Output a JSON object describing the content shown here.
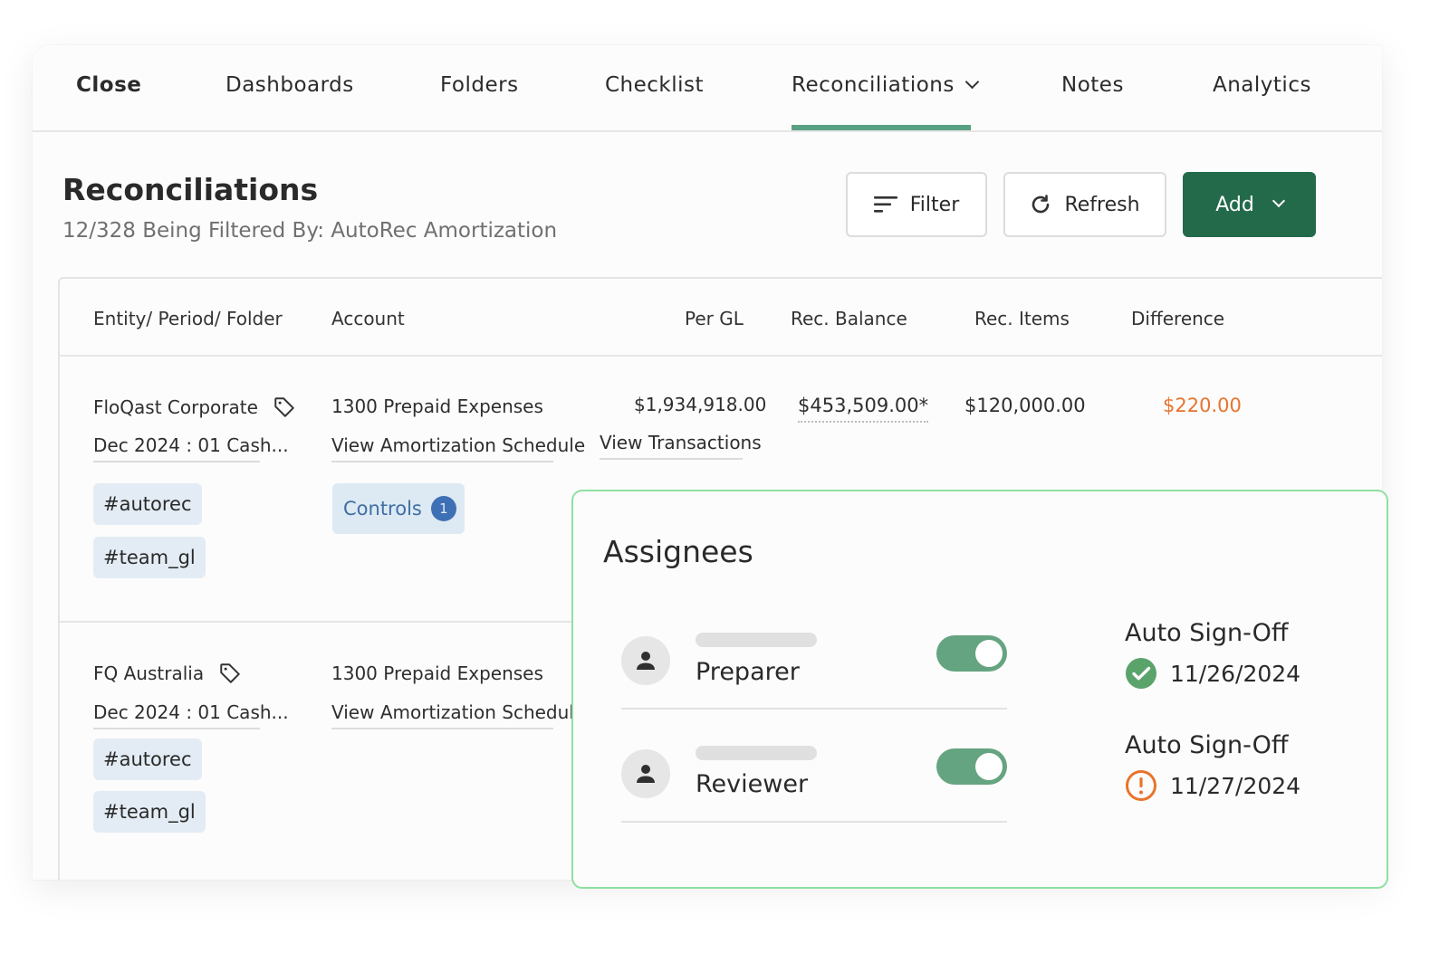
{
  "nav": {
    "items": [
      {
        "label": "Close"
      },
      {
        "label": "Dashboards"
      },
      {
        "label": "Folders"
      },
      {
        "label": "Checklist"
      },
      {
        "label": "Reconciliations"
      },
      {
        "label": "Notes"
      },
      {
        "label": "Analytics"
      }
    ],
    "active": "Reconciliations"
  },
  "page": {
    "title": "Reconciliations",
    "subtitle": "12/328 Being Filtered By: AutoRec Amortization"
  },
  "toolbar": {
    "filter_label": "Filter",
    "refresh_label": "Refresh",
    "add_label": "Add"
  },
  "table": {
    "columns": [
      "Entity/ Period/ Folder",
      "Account",
      "Per GL",
      "Rec. Balance",
      "Rec. Items",
      "Difference"
    ],
    "rows": [
      {
        "entity": "FloQast Corporate",
        "period": "Dec 2024 : 01 Cash...",
        "tags": [
          "#autorec",
          "#team_gl"
        ],
        "account": "1300 Prepaid Expenses",
        "account_link": "View Amortization Schedule",
        "controls_label": "Controls",
        "controls_count": "1",
        "per_gl": "$1,934,918.00",
        "per_gl_link": "View Transactions",
        "rec_balance": "$453,509.00*",
        "rec_items": "$120,000.00",
        "difference": "$220.00"
      },
      {
        "entity": "FQ Australia",
        "period": "Dec 2024 : 01 Cash...",
        "tags": [
          "#autorec",
          "#team_gl"
        ],
        "account": "1300 Prepaid Expenses",
        "account_link": "View Amortization Schedule"
      }
    ]
  },
  "assignees": {
    "title": "Assignees",
    "items": [
      {
        "role": "Preparer",
        "toggle_on": true,
        "auto_label": "Auto Sign-Off",
        "date": "11/26/2024",
        "status": "complete",
        "status_icon": "check-circle-icon"
      },
      {
        "role": "Reviewer",
        "toggle_on": true,
        "auto_label": "Auto Sign-Off",
        "date": "11/27/2024",
        "status": "warning",
        "status_icon": "alert-circle-icon"
      }
    ]
  },
  "colors": {
    "accent_green": "#236a4b",
    "tab_underline": "#5aa083",
    "difference": "#e8742d",
    "popup_border": "#8ee0a0",
    "check": "#5aa36b",
    "warning": "#e8742d"
  }
}
